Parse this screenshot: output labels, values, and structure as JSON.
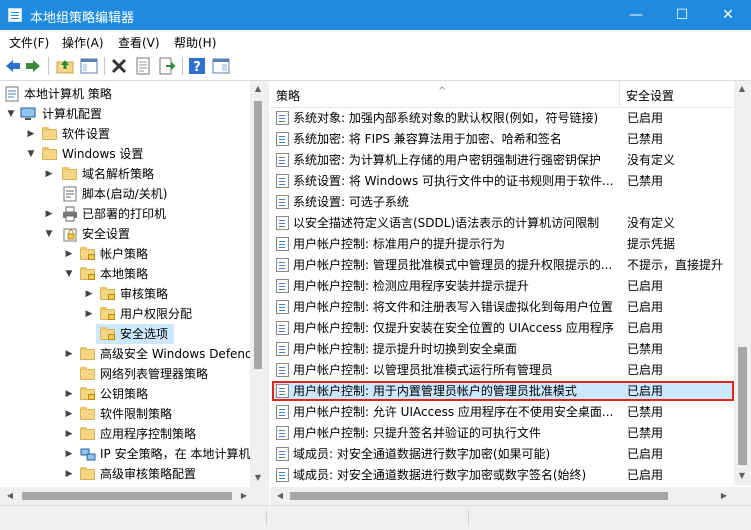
{
  "window": {
    "title": "本地组策略编辑器",
    "controls": {
      "minimize": "—",
      "maximize": "☐",
      "close": "✕"
    },
    "accent_color": "#1e8be0"
  },
  "menu": [
    "文件(F)",
    "操作(A)",
    "查看(V)",
    "帮助(H)"
  ],
  "toolbar_icons": [
    "back-arrow-icon",
    "forward-arrow-icon",
    "up-folder-icon",
    "show-hide-tree-icon",
    "delete-icon",
    "properties-icon",
    "export-list-icon",
    "help-icon",
    "show-console-icon"
  ],
  "tree": [
    {
      "label": "本地计算机 策略",
      "icon": "policy-icon",
      "expanded": null
    },
    {
      "label": "计算机配置",
      "icon": "computer-icon",
      "expanded": true
    },
    {
      "label": "软件设置",
      "icon": "folder-icon",
      "expanded": false
    },
    {
      "label": "Windows 设置",
      "icon": "folder-icon",
      "expanded": true
    },
    {
      "label": "域名解析策略",
      "icon": "folder-icon",
      "expanded": false
    },
    {
      "label": "脚本(启动/关机)",
      "icon": "script-icon",
      "expanded": null
    },
    {
      "label": "已部署的打印机",
      "icon": "printer-icon",
      "expanded": false
    },
    {
      "label": "安全设置",
      "icon": "security-icon",
      "expanded": true
    },
    {
      "label": "帐户策略",
      "icon": "lock-folder-icon",
      "expanded": false
    },
    {
      "label": "本地策略",
      "icon": "lock-folder-icon",
      "expanded": true
    },
    {
      "label": "审核策略",
      "icon": "lock-folder-icon",
      "expanded": false
    },
    {
      "label": "用户权限分配",
      "icon": "lock-folder-icon",
      "expanded": false
    },
    {
      "label": "安全选项",
      "icon": "lock-folder-icon",
      "expanded": null,
      "selected": true
    },
    {
      "label": "高级安全 Windows Defender",
      "icon": "folder-icon",
      "expanded": false
    },
    {
      "label": "网络列表管理器策略",
      "icon": "folder-icon",
      "expanded": null
    },
    {
      "label": "公钥策略",
      "icon": "lock-folder-icon",
      "expanded": false
    },
    {
      "label": "软件限制策略",
      "icon": "folder-icon",
      "expanded": false
    },
    {
      "label": "应用程序控制策略",
      "icon": "folder-icon",
      "expanded": false
    },
    {
      "label": "IP 安全策略，在 本地计算机",
      "icon": "network-icon",
      "expanded": false
    },
    {
      "label": "高级审核策略配置",
      "icon": "folder-icon",
      "expanded": false
    }
  ],
  "columns": {
    "policy": "策略",
    "setting": "安全设置"
  },
  "policies": [
    {
      "policy": "系统对象: 加强内部系统对象的默认权限(例如，符号链接)",
      "setting": "已启用"
    },
    {
      "policy": "系统加密: 将 FIPS 兼容算法用于加密、哈希和签名",
      "setting": "已禁用"
    },
    {
      "policy": "系统加密: 为计算机上存储的用户密钥强制进行强密钥保护",
      "setting": "没有定义"
    },
    {
      "policy": "系统设置: 将 Windows 可执行文件中的证书规则用于软件...",
      "setting": "已禁用"
    },
    {
      "policy": "系统设置: 可选子系统",
      "setting": ""
    },
    {
      "policy": "以安全描述符定义语言(SDDL)语法表示的计算机访问限制",
      "setting": "没有定义"
    },
    {
      "policy": "用户帐户控制: 标准用户的提升提示行为",
      "setting": "提示凭据"
    },
    {
      "policy": "用户帐户控制: 管理员批准模式中管理员的提升权限提示的...",
      "setting": "不提示，直接提升"
    },
    {
      "policy": "用户帐户控制: 检测应用程序安装并提示提升",
      "setting": "已启用"
    },
    {
      "policy": "用户帐户控制: 将文件和注册表写入错误虚拟化到每用户位置",
      "setting": "已启用"
    },
    {
      "policy": "用户帐户控制: 仅提升安装在安全位置的 UIAccess 应用程序",
      "setting": "已启用"
    },
    {
      "policy": "用户帐户控制: 提示提升时切换到安全桌面",
      "setting": "已禁用"
    },
    {
      "policy": "用户帐户控制: 以管理员批准模式运行所有管理员",
      "setting": "已启用"
    },
    {
      "policy": "用户帐户控制: 用于内置管理员帐户的管理员批准模式",
      "setting": "已启用",
      "highlighted": true
    },
    {
      "policy": "用户帐户控制: 允许 UIAccess 应用程序在不使用安全桌面...",
      "setting": "已禁用"
    },
    {
      "policy": "用户帐户控制: 只提升签名并验证的可执行文件",
      "setting": "已禁用"
    },
    {
      "policy": "域成员: 对安全通道数据进行数字加密(如果可能)",
      "setting": "已启用"
    },
    {
      "policy": "域成员: 对安全通道数据进行数字加密或数字签名(始终)",
      "setting": "已启用"
    }
  ],
  "highlight_color": "#e2261b",
  "selection_color": "#cce8ff"
}
